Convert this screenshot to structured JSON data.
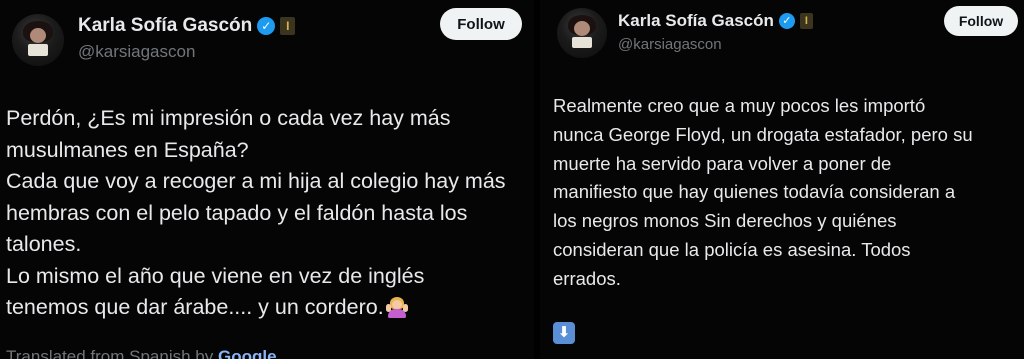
{
  "left_tweet": {
    "author": {
      "name": "Karla Sofía Gascón",
      "handle": "@karsiagascon",
      "verified_glyph": "✓",
      "affiliation_glyph": "I",
      "avatar_icon": "avatar-photo"
    },
    "follow_label": "Follow",
    "text_lines": [
      "Perdón, ¿Es mi impresión o cada vez hay más",
      "musulmanes en España?",
      "Cada que voy a recoger a mi hija al colegio hay más",
      "hembras con el pelo tapado y el faldón hasta los",
      "talones.",
      "Lo mismo el año que viene en vez de inglés",
      "tenemos que dar árabe.... y un cordero."
    ],
    "trailing_emoji": "person-shrugging-emoji",
    "translated_prefix": "Translated from Spanish by ",
    "translated_brand": "Google"
  },
  "right_tweet": {
    "author": {
      "name": "Karla Sofía Gascón",
      "handle": "@karsiagascon",
      "verified_glyph": "✓",
      "affiliation_glyph": "I",
      "avatar_icon": "avatar-photo"
    },
    "follow_label": "Follow",
    "text_lines": [
      "Realmente creo que a muy pocos les importó",
      "nunca George Floyd, un drogata estafador, pero su",
      "muerte ha servido para volver a poner de",
      "manifiesto que hay quienes todavía consideran a",
      "los negros monos Sin derechos y quiénes",
      "consideran que la policía es asesina. Todos",
      "errados."
    ],
    "down_arrow_glyph": "⬇"
  },
  "colors": {
    "background": "#000000",
    "text": "#e7e9ea",
    "muted": "#71767b",
    "verified_blue": "#1d9bf0",
    "affiliation_gold": "#d8b24a",
    "follow_bg": "#eff3f4"
  }
}
